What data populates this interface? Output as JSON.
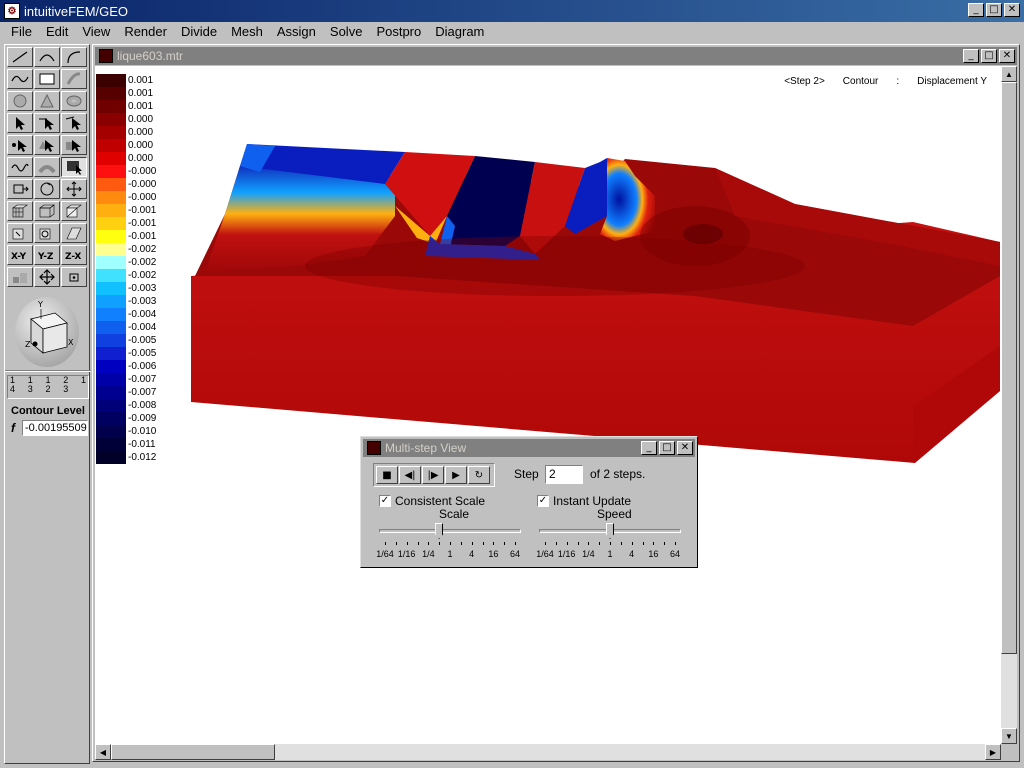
{
  "app": {
    "title": "intuitiveFEM/GEO",
    "icon": "app-logo-icon"
  },
  "menu": [
    "File",
    "Edit",
    "View",
    "Render",
    "Divide",
    "Mesh",
    "Assign",
    "Solve",
    "Postpro",
    "Diagram"
  ],
  "toolbox": {
    "tools": [
      "line-tool-icon",
      "arc-tool-icon",
      "curve-arc-tool-icon",
      "spline-tool-icon",
      "rectangle-tool-icon",
      "surface-tool-icon",
      "sphere-tool-icon",
      "cone-tool-icon",
      "torus-tool-icon",
      "select-tool-icon",
      "select-edge-tool-icon",
      "select-face-tool-icon",
      "select-node-tool-icon",
      "select-element-tool-icon",
      "select-solid-tool-icon",
      "wave-tool-icon",
      "blend-tool-icon",
      "contour-tool-icon",
      "move-tool-icon",
      "rotate-tool-icon",
      "pan-tool-icon",
      "box-mesh-icon",
      "box-wire-icon",
      "box-split-icon",
      "extrude-icon",
      "sweep-icon",
      "shade-icon",
      "xy-plane-icon",
      "yz-plane-icon",
      "zx-plane-icon",
      "fit-view-icon",
      "zoom-view-icon",
      "point-view-icon"
    ],
    "view_steps": [
      {
        "top": "1",
        "bottom": "4"
      },
      {
        "top": "1",
        "bottom": "3"
      },
      {
        "top": "1",
        "bottom": "2"
      },
      {
        "top": "2",
        "bottom": "3"
      },
      {
        "top": "",
        "bottom": "1"
      }
    ],
    "contour_level_label": "Contour Level",
    "f_label": "f",
    "contour_level_value": "-0.00195509"
  },
  "document": {
    "title": "lique603.mtr",
    "header": {
      "step": "<Step 2>",
      "mode": "Contour",
      "sep": ":",
      "field": "Displacement Y"
    },
    "legend": [
      {
        "value": "0.001",
        "color": "#3b0000"
      },
      {
        "value": "0.001",
        "color": "#560000"
      },
      {
        "value": "0.001",
        "color": "#700000"
      },
      {
        "value": "0.000",
        "color": "#8a0000"
      },
      {
        "value": "0.000",
        "color": "#a50000"
      },
      {
        "value": "0.000",
        "color": "#c00000"
      },
      {
        "value": "0.000",
        "color": "#e00000"
      },
      {
        "value": "-0.000",
        "color": "#ff1010"
      },
      {
        "value": "-0.000",
        "color": "#ff5a10"
      },
      {
        "value": "-0.000",
        "color": "#ff8a10"
      },
      {
        "value": "-0.001",
        "color": "#ffb010"
      },
      {
        "value": "-0.001",
        "color": "#ffd010"
      },
      {
        "value": "-0.001",
        "color": "#ffff10"
      },
      {
        "value": "-0.002",
        "color": "#ffff90"
      },
      {
        "value": "-0.002",
        "color": "#a0ffff"
      },
      {
        "value": "-0.002",
        "color": "#40e0ff"
      },
      {
        "value": "-0.003",
        "color": "#10c0ff"
      },
      {
        "value": "-0.003",
        "color": "#10a0ff"
      },
      {
        "value": "-0.004",
        "color": "#1080ff"
      },
      {
        "value": "-0.004",
        "color": "#1060f0"
      },
      {
        "value": "-0.005",
        "color": "#1040e0"
      },
      {
        "value": "-0.005",
        "color": "#1020d0"
      },
      {
        "value": "-0.006",
        "color": "#0000c0"
      },
      {
        "value": "-0.007",
        "color": "#0000a8"
      },
      {
        "value": "-0.007",
        "color": "#000090"
      },
      {
        "value": "-0.008",
        "color": "#000078"
      },
      {
        "value": "-0.009",
        "color": "#000060"
      },
      {
        "value": "-0.010",
        "color": "#00004c"
      },
      {
        "value": "-0.011",
        "color": "#000038"
      },
      {
        "value": "-0.012",
        "color": "#000028"
      }
    ]
  },
  "multistep": {
    "title": "Multi-step View",
    "step_label": "Step",
    "step_value": "2",
    "of_steps": "of 2 steps.",
    "consistent_scale": {
      "label": "Consistent Scale",
      "checked": true
    },
    "instant_update": {
      "label": "Instant Update",
      "checked": true
    },
    "scale": {
      "label": "Scale",
      "ticks": [
        "1/64",
        "1/16",
        "1/4",
        "1",
        "4",
        "16",
        "64"
      ],
      "value_index": 2.5
    },
    "speed": {
      "label": "Speed",
      "ticks": [
        "1/64",
        "1/16",
        "1/4",
        "1",
        "4",
        "16",
        "64"
      ],
      "value_index": 3
    },
    "controls": [
      "stop-icon",
      "step-back-icon",
      "step-forward-icon",
      "play-icon",
      "loop-icon"
    ]
  }
}
